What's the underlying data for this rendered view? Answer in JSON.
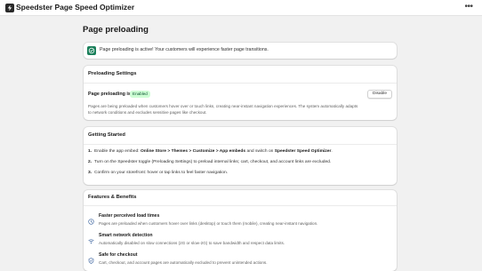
{
  "app": {
    "title": "Speedster Page Speed Optimizer"
  },
  "page": {
    "heading": "Page preloading"
  },
  "banner": {
    "text": "Page preloading is active! Your customers will experience faster page transitions."
  },
  "preloading_settings": {
    "title": "Preloading Settings",
    "status_label": "Page preloading is",
    "status_badge": "Enabled",
    "disable_button": "Disable",
    "description": "Pages are being preloaded when customers hover over or touch links, creating near-instant navigation experiences. The system automatically adapts to network conditions and excludes sensitive pages like checkout."
  },
  "getting_started": {
    "title": "Getting Started",
    "steps": [
      {
        "num": "1.",
        "pre": "Enable the app embed: ",
        "bold1": "Online Store > Themes > Customize > App embeds",
        "mid": " and switch on ",
        "bold2": "Speedster Speed Optimizer",
        "post": "."
      },
      {
        "num": "2.",
        "text": "Turn on the Speedster toggle (Preloading Settings) to preload internal links; cart, checkout, and account links are excluded."
      },
      {
        "num": "3.",
        "text": "Confirm on your storefront: hover or tap links to feel faster navigation."
      }
    ]
  },
  "features": {
    "title": "Features & Benefits",
    "items": [
      {
        "icon": "clock-icon",
        "title": "Faster perceived load times",
        "desc": "Pages are preloaded when customers hover over links (desktop) or touch them (mobile), creating near-instant navigation."
      },
      {
        "icon": "wifi-icon",
        "title": "Smart network detection",
        "desc": "Automatically disabled on slow connections (2G or slow-2G) to save bandwidth and respect data limits."
      },
      {
        "icon": "shield-icon",
        "title": "Safe for checkout",
        "desc": "Cart, checkout, and account pages are automatically excluded to prevent unintended actions."
      }
    ]
  },
  "colors": {
    "accent_green": "#1a7f5a",
    "badge_bg": "#cdfed4",
    "feature_icon": "#4a6fa5"
  }
}
